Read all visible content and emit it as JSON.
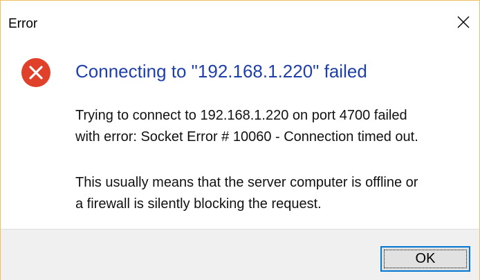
{
  "window": {
    "title": "Error"
  },
  "dialog": {
    "main_instruction": "Connecting to \"192.168.1.220\" failed",
    "paragraph1_line1": "Trying to connect to 192.168.1.220 on port 4700 failed",
    "paragraph1_line2": "with error: Socket Error # 10060 - Connection timed out.",
    "paragraph2_line1": "This usually means that the server computer is offline or",
    "paragraph2_line2": "a firewall is silently blocking the request."
  },
  "buttons": {
    "ok_label": "OK"
  },
  "icons": {
    "error": "error-icon",
    "close": "close-icon"
  },
  "colors": {
    "heading": "#1f40a8",
    "error_icon": "#e0412a",
    "button_border": "#0078d7"
  }
}
